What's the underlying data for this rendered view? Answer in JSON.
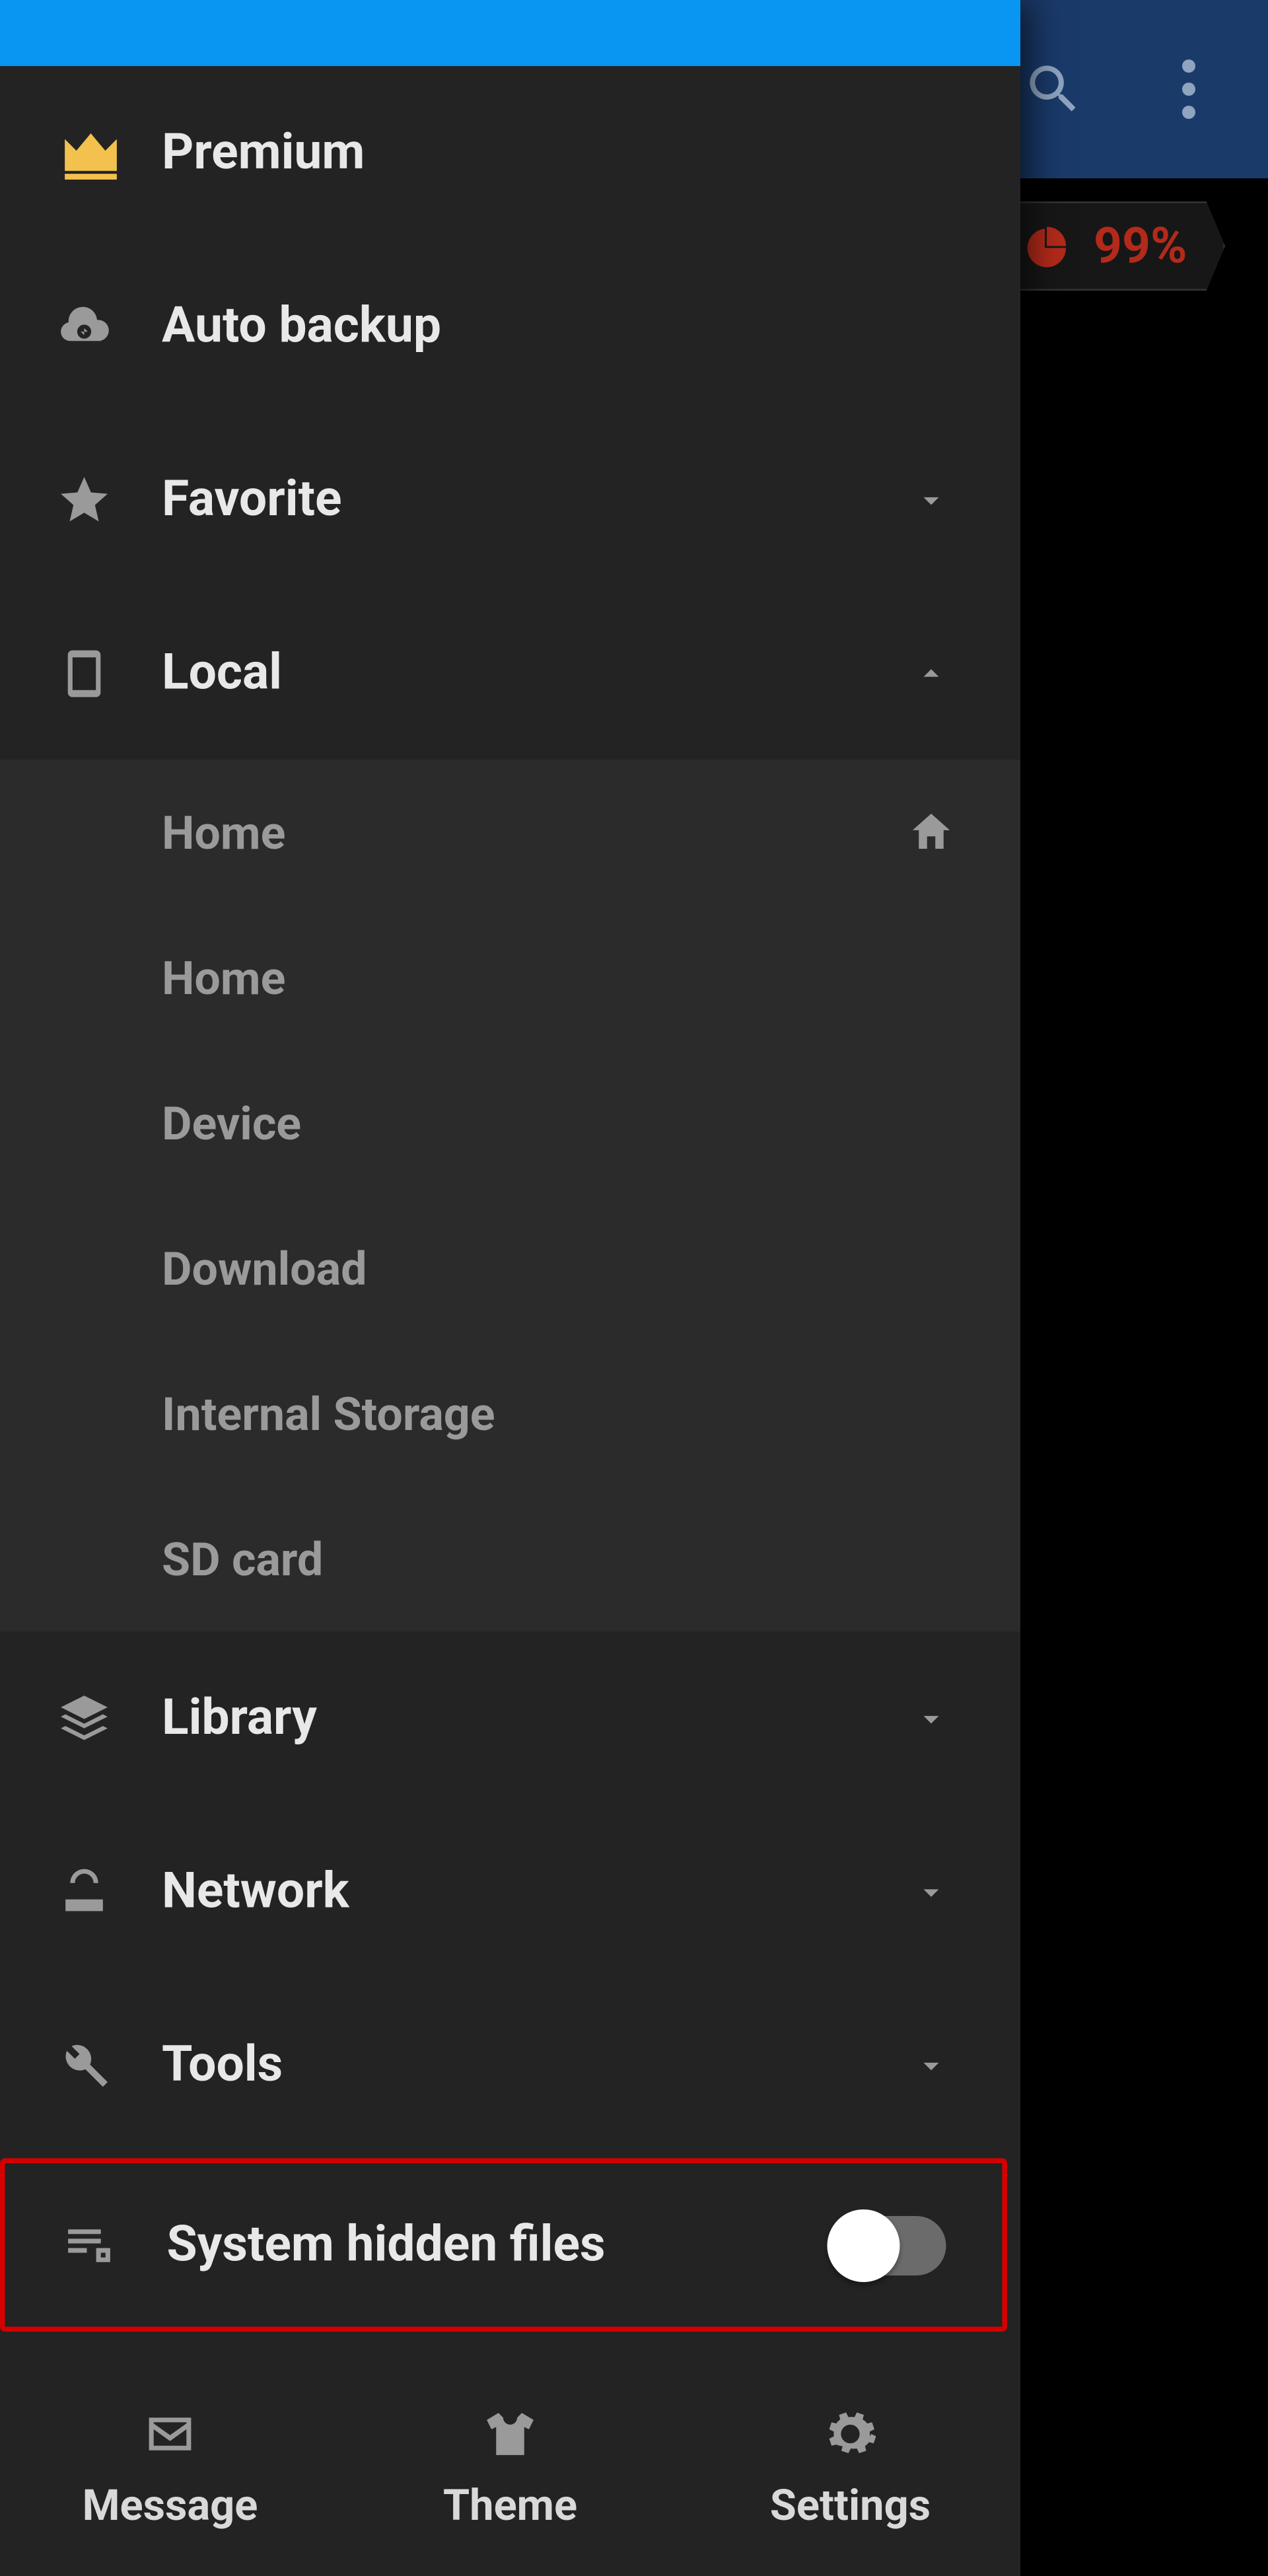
{
  "app_header": {
    "search": "search",
    "menu": "more"
  },
  "storage_badge": {
    "value": "99%"
  },
  "drawer": {
    "premium": "Premium",
    "auto_backup": "Auto backup",
    "favorite": "Favorite",
    "local": "Local",
    "local_items": {
      "home1": "Home",
      "home2": "Home",
      "device": "Device",
      "download": "Download",
      "internal": "Internal Storage",
      "sdcard": "SD card"
    },
    "library": "Library",
    "network": "Network",
    "tools": "Tools",
    "hidden": "System hidden files"
  },
  "bottom_nav": {
    "message": "Message",
    "theme": "Theme",
    "settings": "Settings"
  }
}
